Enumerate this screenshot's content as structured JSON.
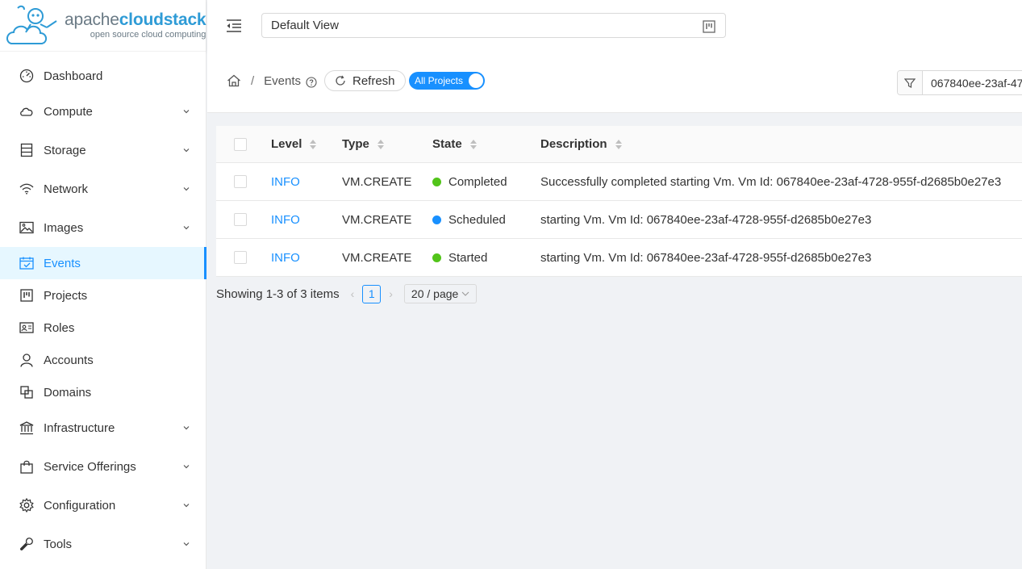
{
  "logo": {
    "brand_a": "apache",
    "brand_b": "cloudstack",
    "tagline": "open source cloud computing"
  },
  "header": {
    "view": "Default View"
  },
  "sidebar": {
    "items": [
      {
        "label": "Dashboard",
        "icon": "dashboard-icon"
      },
      {
        "label": "Compute",
        "icon": "cloud-icon"
      },
      {
        "label": "Storage",
        "icon": "database-icon"
      },
      {
        "label": "Network",
        "icon": "wifi-icon"
      },
      {
        "label": "Images",
        "icon": "picture-icon"
      },
      {
        "label": "Events",
        "icon": "schedule-icon"
      },
      {
        "label": "Projects",
        "icon": "project-icon"
      },
      {
        "label": "Roles",
        "icon": "idcard-icon"
      },
      {
        "label": "Accounts",
        "icon": "user-icon"
      },
      {
        "label": "Domains",
        "icon": "block-icon"
      },
      {
        "label": "Infrastructure",
        "icon": "bank-icon"
      },
      {
        "label": "Service Offerings",
        "icon": "shopping-icon"
      },
      {
        "label": "Configuration",
        "icon": "setting-icon"
      },
      {
        "label": "Tools",
        "icon": "tool-icon"
      }
    ]
  },
  "breadcrumb": {
    "current": "Events"
  },
  "toolbar": {
    "refresh": "Refresh",
    "all_projects": "All Projects",
    "filter_value": "067840ee-23af-47"
  },
  "table": {
    "headers": {
      "level": "Level",
      "type": "Type",
      "state": "State",
      "description": "Description"
    },
    "rows": [
      {
        "level": "INFO",
        "type": "VM.CREATE",
        "state": "Completed",
        "description": "Successfully completed starting Vm. Vm Id: 067840ee-23af-4728-955f-d2685b0e27e3"
      },
      {
        "level": "INFO",
        "type": "VM.CREATE",
        "state": "Scheduled",
        "description": "starting Vm. Vm Id: 067840ee-23af-4728-955f-d2685b0e27e3"
      },
      {
        "level": "INFO",
        "type": "VM.CREATE",
        "state": "Started",
        "description": "starting Vm. Vm Id: 067840ee-23af-4728-955f-d2685b0e27e3"
      }
    ]
  },
  "pagination": {
    "summary": "Showing 1-3 of 3 items",
    "page": "1",
    "size": "20 / page"
  },
  "colors": {
    "accent": "#1890ff",
    "completed": "#52c41a",
    "scheduled": "#1890ff",
    "started": "#52c41a"
  }
}
